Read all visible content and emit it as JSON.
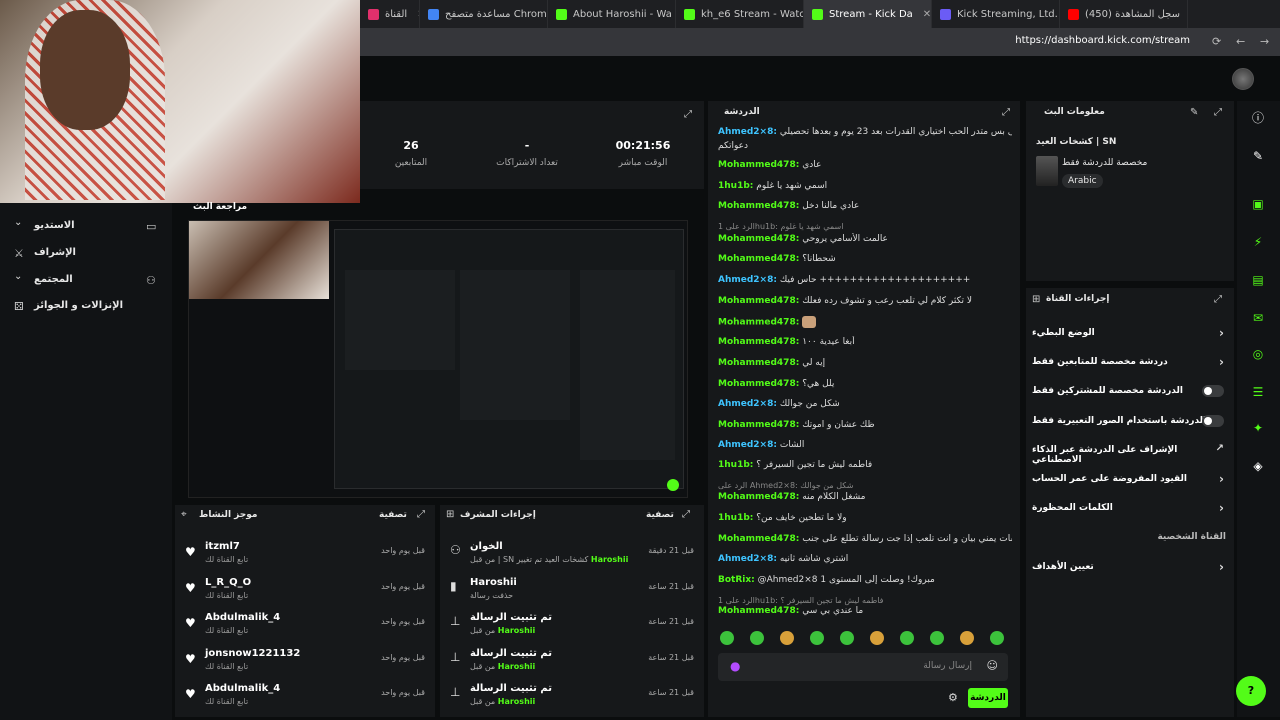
{
  "browser": {
    "tabs": [
      {
        "label": "القناة",
        "color": "#e1306c"
      },
      {
        "label": "مساعدة متصفح Chrome",
        "color": "#4285f4"
      },
      {
        "label": "About Haroshii - Wa",
        "color": "#53fc18"
      },
      {
        "label": "kh_e6 Stream - Watc",
        "color": "#53fc18"
      },
      {
        "label": "Stream - Kick Da",
        "color": "#53fc18",
        "active": true
      },
      {
        "label": "Kick Streaming, Ltd.",
        "color": "#6b5cf5"
      },
      {
        "label": "(450) سجل المشاهدة",
        "color": "#ff0000"
      }
    ],
    "url": "https://dashboard.kick.com/stream"
  },
  "sidebar": {
    "items": [
      {
        "label": "الاستديو",
        "icon": "studio-icon"
      },
      {
        "label": "الإشراف",
        "icon": "sword-icon"
      },
      {
        "label": "المجتمع",
        "icon": "people-icon"
      },
      {
        "label": "الإنزالات و الجوائز",
        "icon": "gift-icon"
      }
    ]
  },
  "stats": {
    "followers_value": "26",
    "followers_label": "المتابعين",
    "subs_value": "-",
    "subs_label": "تعداد الاشتراكات",
    "live_value": "00:21:56",
    "live_label": "الوقت مباشر"
  },
  "preview": {
    "title": "مراجعة البث"
  },
  "activity": {
    "title": "موجز النشاط",
    "filter_label": "تصفية",
    "items": [
      {
        "name": "itzml7",
        "sub": "تابع القناة لك",
        "time": "قبل يوم واحد"
      },
      {
        "name": "L_R_Q_O",
        "sub": "تابع القناة لك",
        "time": "قبل يوم واحد"
      },
      {
        "name": "Abdulmalik_4",
        "sub": "تابع القناة لك",
        "time": "قبل يوم واحد"
      },
      {
        "name": "jonsnow1221132",
        "sub": "تابع القناة لك",
        "time": "قبل يوم واحد"
      },
      {
        "name": "Abdulmalik_4",
        "sub": "تابع القناة لك",
        "time": "قبل يوم واحد"
      }
    ]
  },
  "modactions": {
    "title": "إجراءات المشرف",
    "filter_label": "تصفية",
    "items": [
      {
        "name": "الخوان",
        "sub_pre": "من قبل | SN كشخات العيد تم تغيير ",
        "sub_user": "Haroshii",
        "time": "قبل 21 دقيقة",
        "icon": "user-icon"
      },
      {
        "name": "Haroshii",
        "sub_pre": "حذفت رسالة",
        "sub_user": "",
        "time": "قبل 21 ساعة",
        "icon": "trash-icon"
      },
      {
        "name": "تم تثبيت الرسالة",
        "sub_pre": "من قبل ",
        "sub_user": "Haroshii",
        "time": "قبل 21 ساعة",
        "icon": "pin-icon"
      },
      {
        "name": "تم تثبيت الرسالة",
        "sub_pre": "من قبل ",
        "sub_user": "Haroshii",
        "time": "قبل 21 ساعة",
        "icon": "pin-icon"
      },
      {
        "name": "تم تثبيت الرسالة",
        "sub_pre": "من قبل ",
        "sub_user": "Haroshii",
        "time": "قبل 21 ساعة",
        "icon": "pin-icon"
      }
    ]
  },
  "chat": {
    "title": "الدردشة",
    "placeholder": "إرسال رسالة",
    "send_label": "الدردشة",
    "messages": [
      {
        "user": "Ahmed2×8:",
        "color": "#3ec4ff",
        "text": "والله وحتى بس متدر الحب اختياري القدرات بعد 23 يوم و بعدها تحصيلي"
      },
      {
        "user": "",
        "color": "#ddd",
        "text": "دعواتكم"
      },
      {
        "user": "Mohammed478:",
        "color": "#53fc18",
        "text": "عادي"
      },
      {
        "user": "1hu1b:",
        "color": "#53fc18",
        "text": "اسمي شهد يا غلوم"
      },
      {
        "user": "Mohammed478:",
        "color": "#53fc18",
        "text": "عادي مالنا دخل"
      },
      {
        "user": "",
        "color": "#888",
        "text": "الرد على 1hu1b: اسمي شهد يا غلوم",
        "reply": true
      },
      {
        "user": "Mohammed478:",
        "color": "#53fc18",
        "text": "عالمت الأسامي يروحي"
      },
      {
        "user": "Mohammed478:",
        "color": "#53fc18",
        "text": "شحطانا؟"
      },
      {
        "user": "Ahmed2×8:",
        "color": "#3ec4ff",
        "text": "حاس فيك ++++++++++++++++++++"
      },
      {
        "user": "Mohammed478:",
        "color": "#53fc18",
        "text": "لا تكثر كلام لي تلعب رعب و تشوف رده فعلك"
      },
      {
        "user": "Mohammed478:",
        "color": "#53fc18",
        "text": ""
      },
      {
        "user": "Mohammed478:",
        "color": "#53fc18",
        "text": "أبغا عيدية ١٠٠"
      },
      {
        "user": "Mohammed478:",
        "color": "#53fc18",
        "text": "إيه لي"
      },
      {
        "user": "Mohammed478:",
        "color": "#53fc18",
        "text": "يلل هي؟"
      },
      {
        "user": "Ahmed2×8:",
        "color": "#3ec4ff",
        "text": "شكل من جوالك"
      },
      {
        "user": "Mohammed478:",
        "color": "#53fc18",
        "text": "ظك عشان و اموتك"
      },
      {
        "user": "Ahmed2×8:",
        "color": "#3ec4ff",
        "text": "الشات"
      },
      {
        "user": "1hu1b:",
        "color": "#53fc18",
        "text": "فاطمه ليش ما تجين السيرفر ؟"
      },
      {
        "user": "",
        "color": "#888",
        "text": "الرد على Ahmed2×8: شكل من جوالك",
        "reply": true
      },
      {
        "user": "Mohammed478:",
        "color": "#53fc18",
        "text": "مشغل الكلام منه"
      },
      {
        "user": "1hu1b:",
        "color": "#53fc18",
        "text": "ولا ما تطحين خايف من؟"
      },
      {
        "user": "Mohammed478:",
        "color": "#53fc18",
        "text": "يمديك تحط الشات يمني بيان و انت تلعب إذا جت رسالة تطلع على جنب"
      },
      {
        "user": "Ahmed2×8:",
        "color": "#3ec4ff",
        "text": "اشتري شاشه ثانيه"
      },
      {
        "user": "BotRix:",
        "color": "#53fc18",
        "text": "@Ahmed2×8 مبروك! وصلت إلى المستوى 1"
      },
      {
        "user": "",
        "color": "#888",
        "text": "الرد على 1hu1b: فاطمه ليش ما تجين السيرفر ؟",
        "reply": true
      },
      {
        "user": "Mohammed478:",
        "color": "#53fc18",
        "text": "ما عندي بي سي"
      }
    ]
  },
  "botinfo": {
    "title": "معلومات البث",
    "stream_title": "كشخات العيد | SN",
    "subtitle": "مخصصة للدردشة فقط",
    "language": "Arabic"
  },
  "chan_actions": {
    "title": "إجراءات القناة",
    "rows": [
      {
        "label": "الوضع البطيء",
        "type": "chevron"
      },
      {
        "label": "دردشة مخصصة للمتابعين فقط",
        "type": "chevron"
      },
      {
        "label": "الدردشة مخصصة للمشتركين فقط",
        "type": "toggle"
      },
      {
        "label": "الدردشة باستخدام الصور التعبيرية فقط",
        "type": "toggle"
      },
      {
        "label": "الإشراف على الدردشة عبر الذكاء الاصطناعي",
        "type": "external"
      },
      {
        "label": "القيود المفروضة على عمر الحساب",
        "type": "chevron"
      },
      {
        "label": "الكلمات المحظورة",
        "type": "chevron"
      },
      {
        "label": "القناة الشخصية",
        "type": "none"
      },
      {
        "label": "تعيين الأهداف",
        "type": "chevron"
      }
    ]
  },
  "colors": {
    "accent": "#53fc18",
    "bg": "#0b0d0e",
    "panel": "#16181a"
  }
}
